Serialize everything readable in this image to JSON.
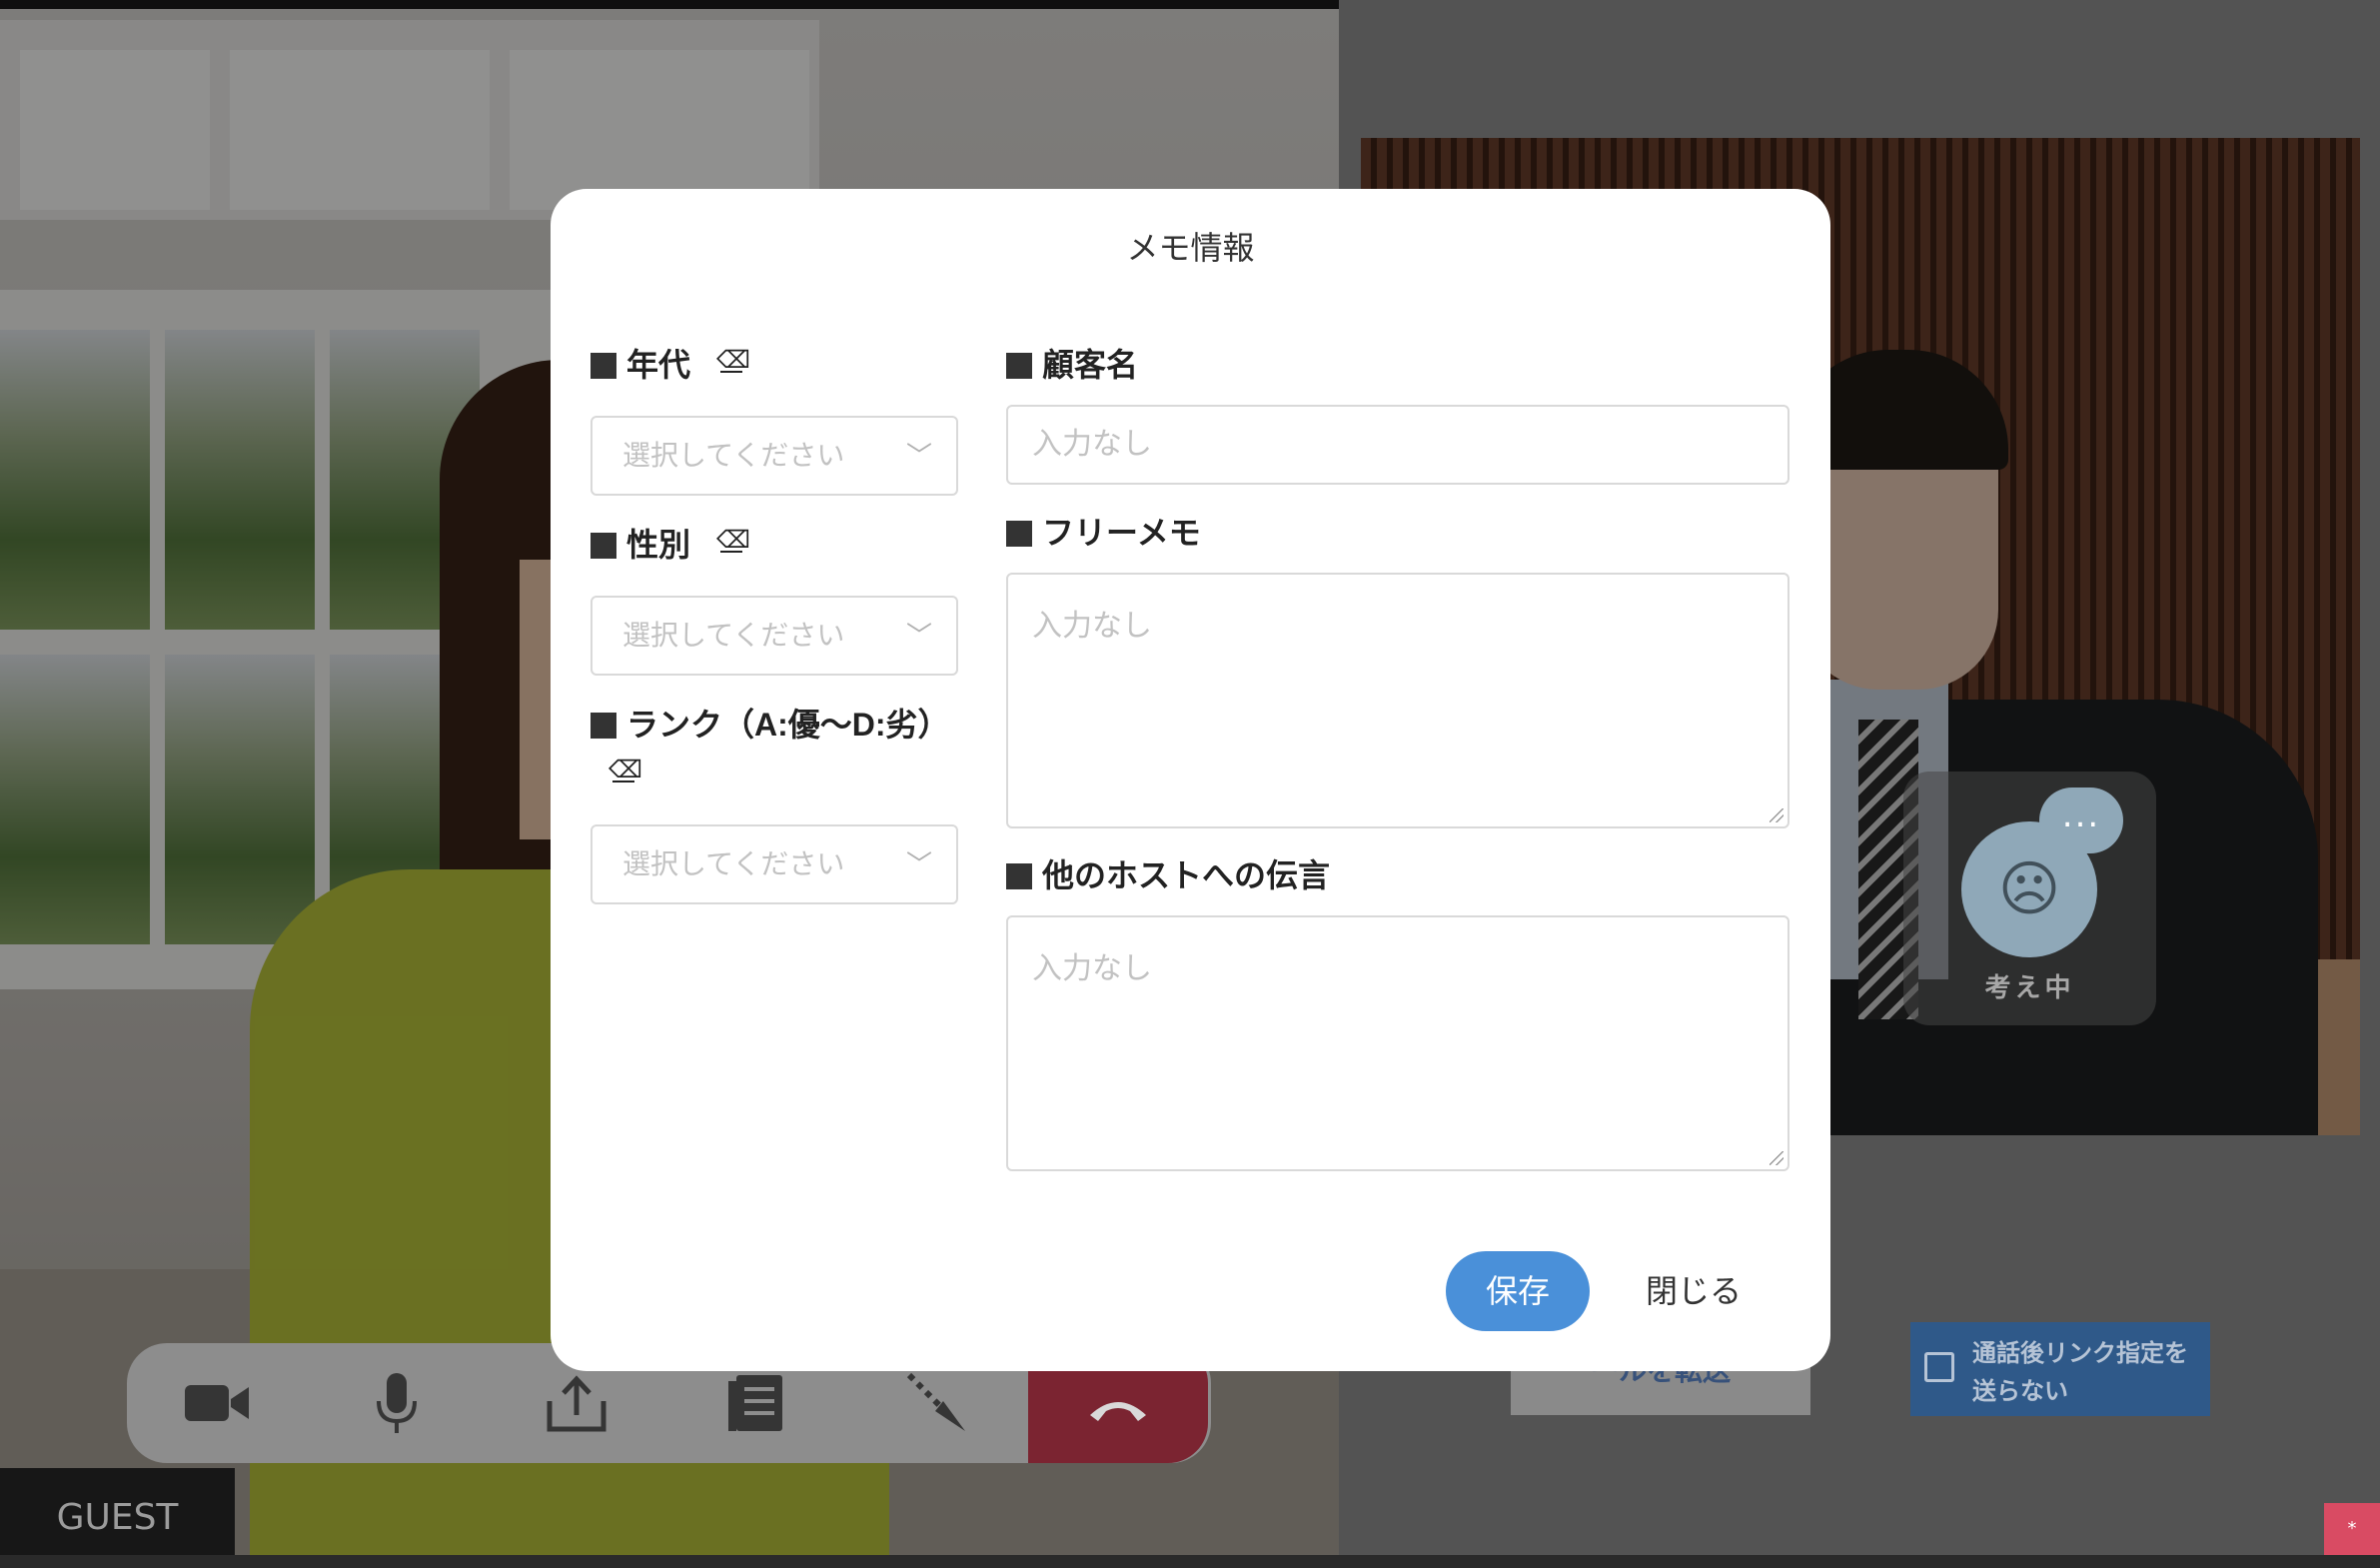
{
  "background": {
    "thinking_status": "考え中",
    "thinking_bubble": "...",
    "transfer_button_label": "ールを転送",
    "no_link_option_label": "通話後リンク指定を送らない",
    "guest_label": "GUEST",
    "corner_badge": "*",
    "call_toolbar": {
      "tools": [
        "camera-icon",
        "microphone-icon",
        "share-icon",
        "document-icon",
        "pointer-icon",
        "hang-up-icon"
      ]
    }
  },
  "modal": {
    "title": "メモ情報",
    "left_fields": [
      {
        "label": "年代",
        "select_placeholder": "選択してください"
      },
      {
        "label": "性別",
        "select_placeholder": "選択してください"
      },
      {
        "label": "ランク（A:優〜D:劣）",
        "select_placeholder": "選択してください"
      }
    ],
    "right_fields": [
      {
        "label": "顧客名",
        "placeholder": "入力なし",
        "type": "input"
      },
      {
        "label": "フリーメモ",
        "placeholder": "入力なし",
        "type": "textarea"
      },
      {
        "label": "他のホストへの伝言",
        "placeholder": "入力なし",
        "type": "textarea"
      }
    ],
    "save_label": "保存",
    "close_label": "閉じる"
  },
  "colors": {
    "accent": "#4a90d9",
    "hangup": "#c43a4f",
    "overlay": "rgba(0,0,0,0.42)"
  }
}
